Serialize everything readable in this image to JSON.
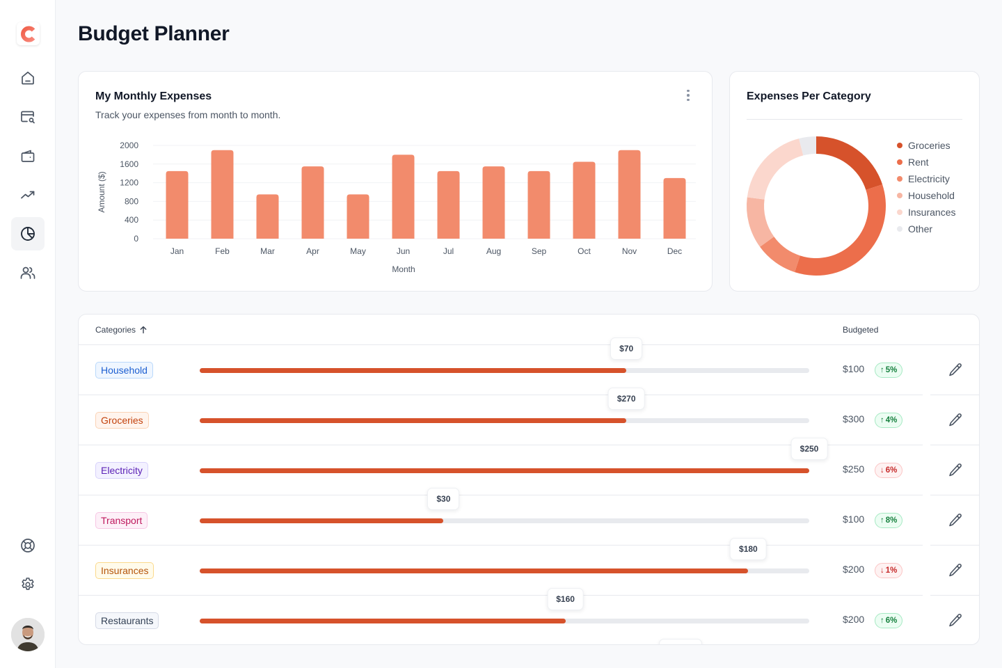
{
  "app": {
    "logo_letter": "C",
    "brand_color": "#f0604a"
  },
  "sidebar": {
    "items": [
      {
        "name": "home",
        "icon": "home-icon",
        "active": false
      },
      {
        "name": "transactions",
        "icon": "card-search-icon",
        "active": false
      },
      {
        "name": "wallet",
        "icon": "wallet-icon",
        "active": false
      },
      {
        "name": "trends",
        "icon": "trending-up-icon",
        "active": false
      },
      {
        "name": "budget",
        "icon": "pie-chart-icon",
        "active": true
      },
      {
        "name": "users",
        "icon": "users-icon",
        "active": false
      }
    ],
    "bottom_items": [
      {
        "name": "support",
        "icon": "lifebuoy-icon"
      },
      {
        "name": "settings",
        "icon": "gear-icon"
      }
    ],
    "avatar": "user-avatar"
  },
  "header": {
    "title": "Budget Planner"
  },
  "monthly_expenses": {
    "title": "My Monthly Expenses",
    "subtitle": "Track your expenses from month to month.",
    "menu_icon": "more-vertical-icon"
  },
  "category_expenses": {
    "title": "Expenses Per Category"
  },
  "chart_data": [
    {
      "type": "bar",
      "title": "My Monthly Expenses",
      "xlabel": "Month",
      "ylabel": "Amount ($)",
      "categories": [
        "Jan",
        "Feb",
        "Mar",
        "Apr",
        "May",
        "Jun",
        "Jul",
        "Aug",
        "Sep",
        "Oct",
        "Nov",
        "Dec"
      ],
      "values": [
        1450,
        1900,
        950,
        1550,
        950,
        1800,
        1450,
        1550,
        1450,
        1650,
        1900,
        1300
      ],
      "ylim": [
        0,
        2000
      ],
      "yticks": [
        0,
        400,
        800,
        1200,
        1600,
        2000
      ],
      "grid": true,
      "color": "#f28b6c"
    },
    {
      "type": "pie",
      "variant": "donut",
      "title": "Expenses Per Category",
      "legend_position": "right",
      "slices": [
        {
          "label": "Groceries",
          "value": 20,
          "color": "#d6522b"
        },
        {
          "label": "Rent",
          "value": 35,
          "color": "#ec6e4b"
        },
        {
          "label": "Electricity",
          "value": 10,
          "color": "#f28b6c"
        },
        {
          "label": "Household",
          "value": 12,
          "color": "#f7b6a3"
        },
        {
          "label": "Insurances",
          "value": 19,
          "color": "#fbd7cd"
        },
        {
          "label": "Other",
          "value": 4,
          "color": "#e9eaee"
        }
      ]
    }
  ],
  "table": {
    "header": {
      "categories": "Categories",
      "sort_icon": "arrow-up-icon",
      "budgeted": "Budgeted"
    },
    "rows": [
      {
        "category": "Household",
        "tag_bg": "#eff6ff",
        "tag_border": "#b9d8fb",
        "tag_color": "#1d5fd1",
        "spent": "$70",
        "progress": 0.7,
        "budgeted": "$100",
        "trend": "up",
        "trend_arrow": "↑",
        "change": "5%"
      },
      {
        "category": "Groceries",
        "tag_bg": "#fff4ed",
        "tag_border": "#fbd3b5",
        "tag_color": "#c2410c",
        "spent": "$270",
        "progress": 0.7,
        "budgeted": "$300",
        "trend": "up",
        "trend_arrow": "↑",
        "change": "4%"
      },
      {
        "category": "Electricity",
        "tag_bg": "#f3f1ff",
        "tag_border": "#d7d1fb",
        "tag_color": "#5b21b6",
        "spent": "$250",
        "progress": 1.0,
        "budgeted": "$250",
        "trend": "down",
        "trend_arrow": "↓",
        "change": "6%"
      },
      {
        "category": "Transport",
        "tag_bg": "#fdf0f8",
        "tag_border": "#f7c6e4",
        "tag_color": "#be185d",
        "spent": "$30",
        "progress": 0.4,
        "budgeted": "$100",
        "trend": "up",
        "trend_arrow": "↑",
        "change": "8%"
      },
      {
        "category": "Insurances",
        "tag_bg": "#fffbeb",
        "tag_border": "#fbd98b",
        "tag_color": "#b45309",
        "spent": "$180",
        "progress": 0.9,
        "budgeted": "$200",
        "trend": "down",
        "trend_arrow": "↓",
        "change": "1%"
      },
      {
        "category": "Restaurants",
        "tag_bg": "#f5f7fb",
        "tag_border": "#d5dae6",
        "tag_color": "#334155",
        "spent": "$160",
        "progress": 0.6,
        "budgeted": "$200",
        "trend": "up",
        "trend_arrow": "↑",
        "change": "6%"
      }
    ],
    "edit_icon": "pencil-icon"
  }
}
